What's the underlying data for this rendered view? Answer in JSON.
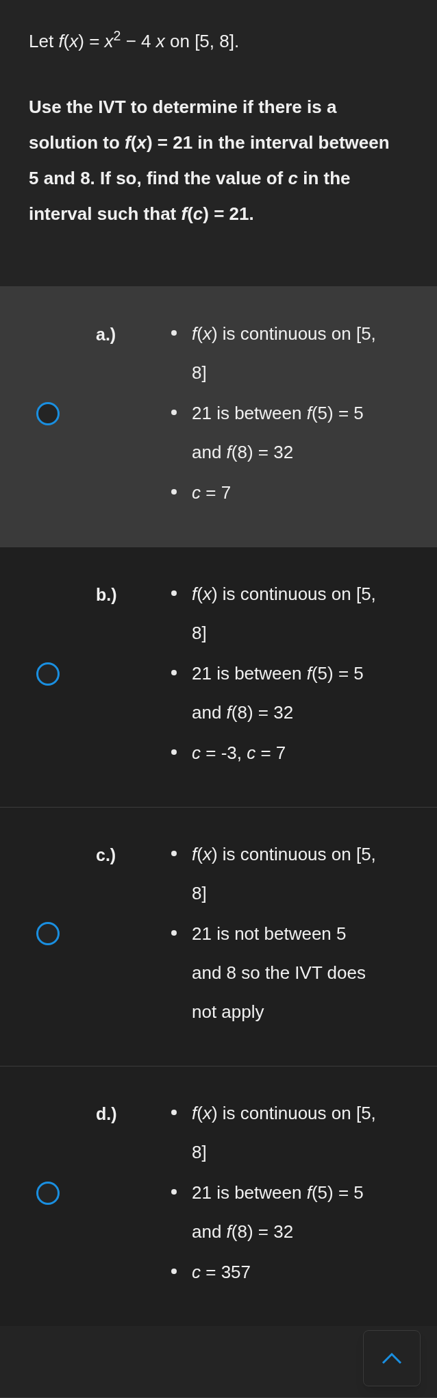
{
  "question": {
    "statement": "Let *f*(*x*) = *x*$^{2}$ − 4 *x* on [5, 8].",
    "prompt": "Use the IVT to determine if there is a solution to *f*(*x*) = 21 in the interval between 5 and 8. If so, find the value of *c* in the interval such that *f*(*c*) = 21."
  },
  "options": [
    {
      "label": "a.)",
      "selected": false,
      "highlighted": true,
      "points": [
        "*f*(*x*) is continuous on [5, 8]",
        "21 is between *f*(5) = 5 and *f*(8) = 32",
        "*c* = 7"
      ]
    },
    {
      "label": "b.)",
      "selected": false,
      "highlighted": false,
      "points": [
        "*f*(*x*) is continuous on [5, 8]",
        "21 is between *f*(5) = 5 and *f*(8) = 32",
        "*c* = -3, *c* = 7"
      ]
    },
    {
      "label": "c.)",
      "selected": false,
      "highlighted": false,
      "points": [
        "*f*(*x*) is continuous on [5, 8]",
        "21 is not between 5 and 8 so the IVT does not apply"
      ]
    },
    {
      "label": "d.)",
      "selected": false,
      "highlighted": false,
      "points": [
        "*f*(*x*) is continuous on [5, 8]",
        "21 is between *f*(5) = 5 and *f*(8) = 32",
        "*c* = 357"
      ]
    }
  ]
}
